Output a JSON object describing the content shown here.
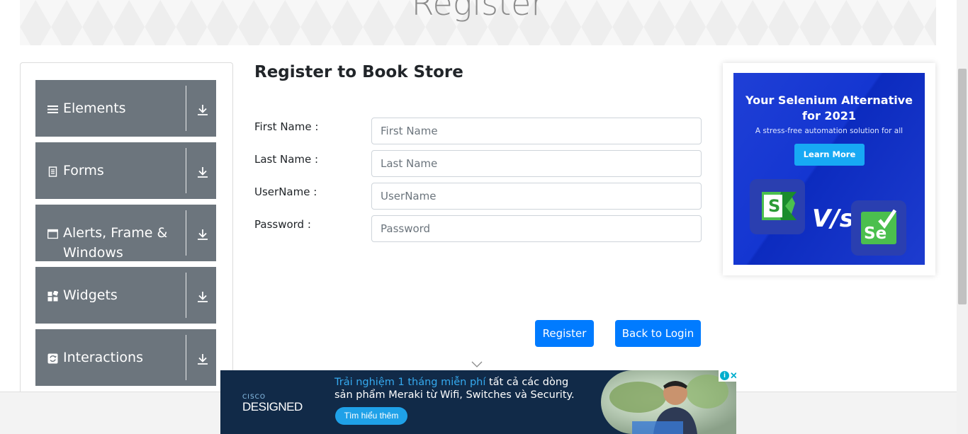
{
  "header": {
    "title": "Register"
  },
  "sidebar": {
    "groups": [
      {
        "label": "Elements",
        "icon": "hamburger-icon"
      },
      {
        "label": "Forms",
        "icon": "document-icon"
      },
      {
        "label": "Alerts, Frame & Windows",
        "icon": "window-icon"
      },
      {
        "label": "Widgets",
        "icon": "widgets-icon"
      },
      {
        "label": "Interactions",
        "icon": "refresh-icon"
      }
    ]
  },
  "form": {
    "title": "Register to Book Store",
    "fields": [
      {
        "label": "First Name :",
        "placeholder": "First Name",
        "value": ""
      },
      {
        "label": "Last Name :",
        "placeholder": "Last Name",
        "value": ""
      },
      {
        "label": "UserName :",
        "placeholder": "UserName",
        "value": ""
      },
      {
        "label": "Password :",
        "placeholder": "Password",
        "value": ""
      }
    ],
    "register_label": "Register",
    "back_label": "Back to Login"
  },
  "side_ad": {
    "headline_1": "Your Selenium Alternative",
    "headline_2": "for 2021",
    "subtitle": "A stress-free automation solution for all",
    "cta": "Learn More",
    "vs": "V/s",
    "logo_left": "S",
    "logo_right": "Se"
  },
  "bottom_ad": {
    "brand_small": "CISCO",
    "brand_big": "DESIGNED",
    "line1_highlight": "Trải nghiệm 1 tháng miễn phí",
    "line1_rest": " tất cả các dòng",
    "line2": "sản phẩm Meraki từ Wifi, Switches và Security.",
    "cta": "Tìm hiểu thêm"
  },
  "colors": {
    "sidebar_bg": "#6c757d",
    "primary": "#007bff",
    "ad_blue": "#1436d1",
    "bottom_ad_bg": "#112a48"
  }
}
